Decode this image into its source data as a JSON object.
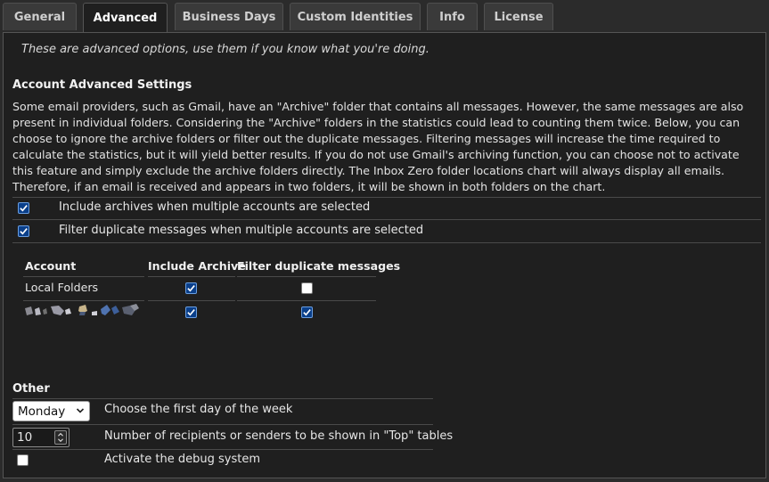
{
  "tabs": [
    {
      "label": "General",
      "active": false
    },
    {
      "label": "Advanced",
      "active": true
    },
    {
      "label": "Business Days",
      "active": false
    },
    {
      "label": "Custom Identities",
      "active": false
    },
    {
      "label": "Info",
      "active": false
    },
    {
      "label": "License",
      "active": false
    }
  ],
  "intro": "These are advanced options, use them if you know what you're doing.",
  "account_settings": {
    "heading": "Account Advanced Settings",
    "description": "Some email providers, such as Gmail, have an \"Archive\" folder that contains all messages. However, the same messages are also present in individual folders. Considering the \"Archive\" folders in the statistics could lead to counting them twice. Below, you can choose to ignore the archive folders or filter out the duplicate messages. Filtering messages will increase the time required to calculate the statistics, but it will yield better results. If you do not use Gmail's archiving function, you can choose not to activate this feature and simply exclude the archive folders directly. The Inbox Zero folder locations chart will always display all emails. Therefore, if an email is received and appears in two folders, it will be shown in both folders on the chart.",
    "options": [
      {
        "label": "Include archives when multiple accounts are selected",
        "checked": true
      },
      {
        "label": "Filter duplicate messages when multiple accounts are selected",
        "checked": true
      }
    ],
    "table": {
      "headers": [
        "Account",
        "Include Archive",
        "Filter duplicate messages"
      ],
      "rows": [
        {
          "account": "Local Folders",
          "include_archive": true,
          "filter_duplicates": false
        },
        {
          "account": "",
          "include_archive": true,
          "filter_duplicates": true
        }
      ]
    }
  },
  "other": {
    "heading": "Other",
    "first_day": {
      "value": "Monday",
      "label": "Choose the first day of the week"
    },
    "top_count": {
      "value": "10",
      "label": "Number of recipients or senders to be shown in \"Top\" tables"
    },
    "debug": {
      "label": "Activate the debug system",
      "checked": false
    }
  },
  "colors": {
    "accent_checkbox": "#0a3f8a",
    "panel_bg": "#1f1f1f",
    "window_bg": "#2b2b2b"
  }
}
